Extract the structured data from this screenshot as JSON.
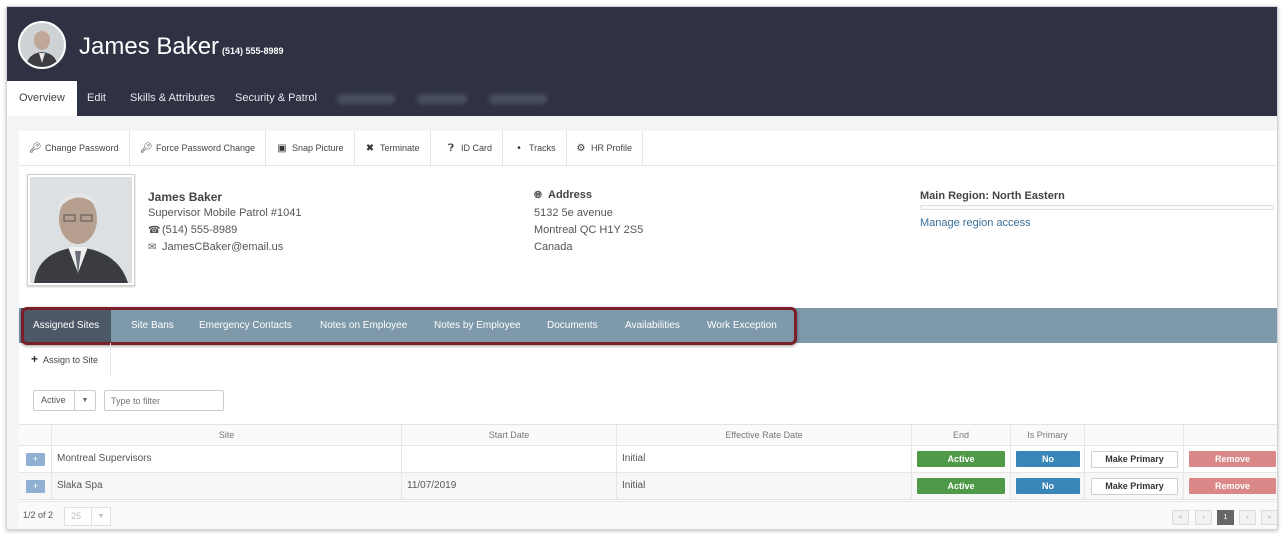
{
  "header": {
    "name": "James Baker",
    "phone": "(514) 555-8989"
  },
  "nav": {
    "tabs": [
      {
        "label": "Overview"
      },
      {
        "label": "Edit"
      },
      {
        "label": "Skills & Attributes"
      },
      {
        "label": "Security & Patrol"
      }
    ]
  },
  "toolbar": {
    "items": [
      {
        "label": "Change Password",
        "icon": "key-icon"
      },
      {
        "label": "Force Password Change",
        "icon": "key-icon"
      },
      {
        "label": "Snap Picture",
        "icon": "camera-icon"
      },
      {
        "label": "Terminate",
        "icon": "close-icon"
      },
      {
        "label": "ID Card",
        "icon": "question-circle-icon"
      },
      {
        "label": "Tracks",
        "icon": "map-pin-icon"
      },
      {
        "label": "HR Profile",
        "icon": "gear-icon"
      }
    ]
  },
  "profile": {
    "name": "James Baker",
    "title": "Supervisor Mobile Patrol #1041",
    "phone": "(514) 555-8989",
    "email": "JamesCBaker@email.us"
  },
  "address": {
    "heading": "Address",
    "line1": "5132 5e avenue",
    "line2": "Montreal QC H1Y 2S5",
    "line3": "Canada"
  },
  "region": {
    "title": "Main Region: North Eastern",
    "link": "Manage region access"
  },
  "subtabs": [
    {
      "label": "Assigned Sites"
    },
    {
      "label": "Site Bans"
    },
    {
      "label": "Emergency Contacts"
    },
    {
      "label": "Notes on Employee"
    },
    {
      "label": "Notes by Employee"
    },
    {
      "label": "Documents"
    },
    {
      "label": "Availabilities"
    },
    {
      "label": "Work Exception"
    }
  ],
  "actions": {
    "assign": "Assign to Site"
  },
  "filter": {
    "status_value": "Active",
    "placeholder": "Type to filter"
  },
  "table": {
    "columns": [
      "Site",
      "Start Date",
      "Effective Rate Date",
      "End",
      "Is Primary"
    ],
    "rows": [
      {
        "expand": "+",
        "site": "Montreal Supervisors",
        "start": "",
        "rate": "Initial",
        "end": "Active",
        "primary": "No",
        "make": "Make Primary",
        "remove": "Remove"
      },
      {
        "expand": "+",
        "site": "Slaka Spa",
        "start": "11/07/2019",
        "rate": "Initial",
        "end": "Active",
        "primary": "No",
        "make": "Make Primary",
        "remove": "Remove"
      }
    ]
  },
  "footer": {
    "count": "1/2 of 2",
    "page_size": "25",
    "pages": [
      "«",
      "‹",
      "1",
      "›",
      "»"
    ]
  },
  "colors": {
    "header_bg": "#2e3243",
    "subtab_bg": "#7e99a9",
    "active_green": "#4e9a48",
    "primary_blue": "#3b86b8",
    "remove_red": "#d98787",
    "highlight": "#7a1f2a"
  }
}
